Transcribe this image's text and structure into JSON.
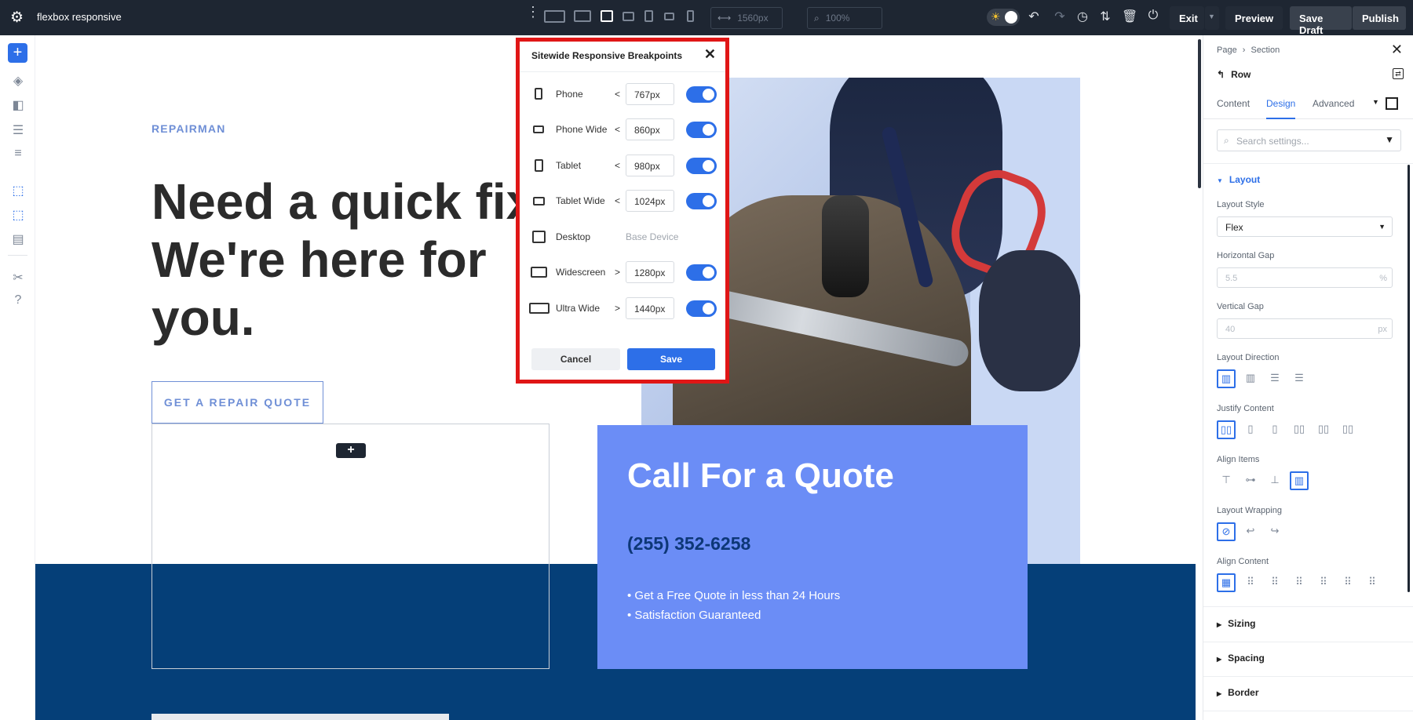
{
  "topbar": {
    "title": "flexbox responsive",
    "width_field": "1560px",
    "zoom_field": "100%",
    "exit_label": "Exit",
    "preview_label": "Preview",
    "save_draft_label": "Save Draft",
    "publish_label": "Publish"
  },
  "page": {
    "eyebrow": "REPAIRMAN",
    "hero_line1": "Need a quick fix",
    "hero_line2": "We're here for",
    "hero_line3": "you.",
    "cta": "GET A REPAIR QUOTE",
    "add_module": "+",
    "quote_title": "Call For a Quote",
    "quote_phone": "(255) 352-6258",
    "quote_bullets": [
      "Get a Free Quote in less than 24 Hours",
      "Satisfaction Guaranteed"
    ]
  },
  "modal": {
    "title": "Sitewide Responsive Breakpoints",
    "breakpoints": [
      {
        "name": "Phone",
        "op": "<",
        "value": "767px",
        "enabled": true
      },
      {
        "name": "Phone Wide",
        "op": "<",
        "value": "860px",
        "enabled": true
      },
      {
        "name": "Tablet",
        "op": "<",
        "value": "980px",
        "enabled": true
      },
      {
        "name": "Tablet Wide",
        "op": "<",
        "value": "1024px",
        "enabled": true
      },
      {
        "name": "Desktop",
        "op": "",
        "value": "Base Device",
        "enabled": null
      },
      {
        "name": "Widescreen",
        "op": ">",
        "value": "1280px",
        "enabled": true
      },
      {
        "name": "Ultra Wide",
        "op": ">",
        "value": "1440px",
        "enabled": true
      }
    ],
    "cancel": "Cancel",
    "save": "Save"
  },
  "panel": {
    "crumb_page": "Page",
    "crumb_sep": "›",
    "crumb_section": "Section",
    "element": "Row",
    "tabs": [
      "Content",
      "Design",
      "Advanced"
    ],
    "active_tab": "Design",
    "search_placeholder": "Search settings...",
    "layout_header": "Layout",
    "layout_style_label": "Layout Style",
    "layout_style_value": "Flex",
    "hgap_label": "Horizontal Gap",
    "hgap_value": "5.5",
    "hgap_unit": "%",
    "vgap_label": "Vertical Gap",
    "vgap_value": "40",
    "vgap_unit": "px",
    "direction_label": "Layout Direction",
    "justify_label": "Justify Content",
    "align_items_label": "Align Items",
    "wrapping_label": "Layout Wrapping",
    "align_content_label": "Align Content",
    "sizing": "Sizing",
    "spacing": "Spacing",
    "border": "Border"
  },
  "colors": {
    "accent": "#2d6fe8",
    "navy": "#053f78",
    "quote_bg": "#6b8df6",
    "highlight": "#e01616"
  }
}
